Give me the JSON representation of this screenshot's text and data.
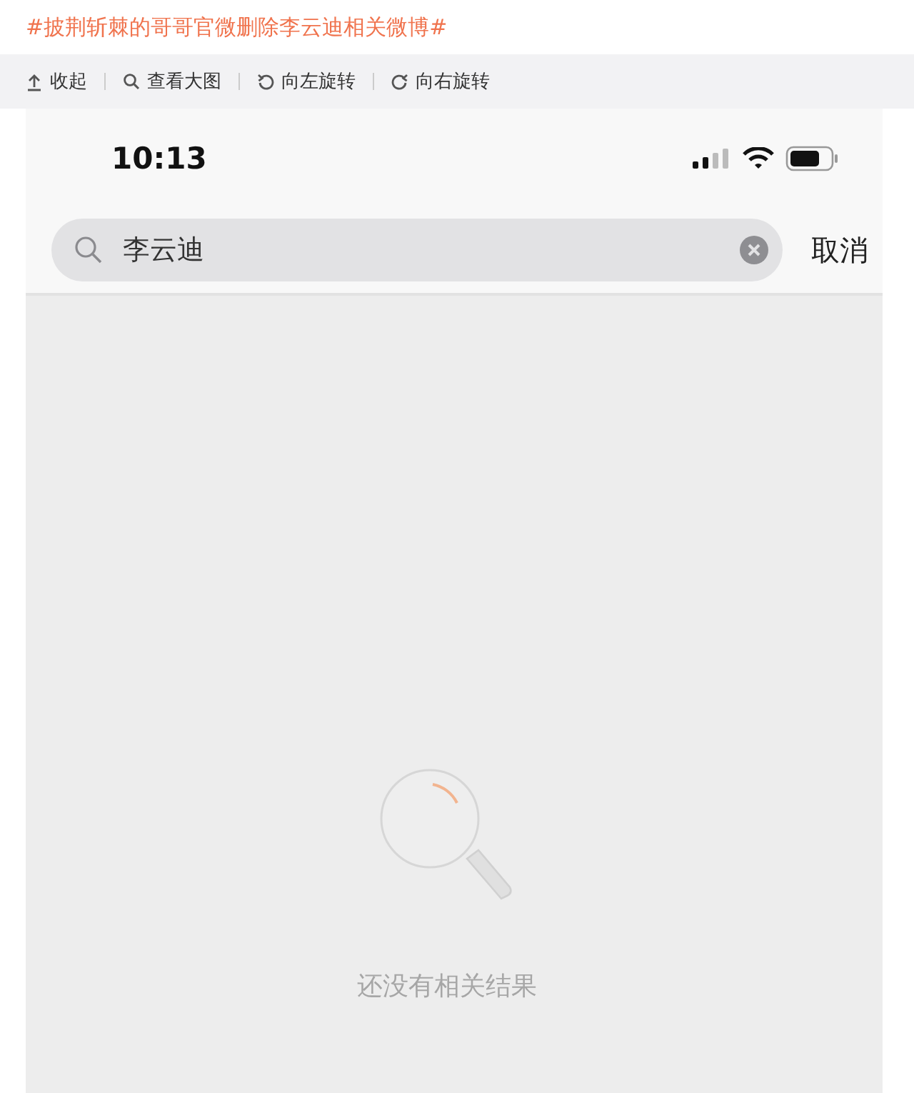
{
  "title": "#披荆斩棘的哥哥官微删除李云迪相关微博#",
  "toolbar": [
    {
      "kind": "collapse",
      "label": "收起"
    },
    {
      "kind": "zoom",
      "label": "查看大图"
    },
    {
      "kind": "rotate_left",
      "label": "向左旋转"
    },
    {
      "kind": "rotate_right",
      "label": "向右旋转"
    }
  ],
  "phone": {
    "time": "10:13",
    "search": {
      "value": "李云迪"
    },
    "cancel": "取消",
    "empty_message": "还没有相关结果"
  }
}
